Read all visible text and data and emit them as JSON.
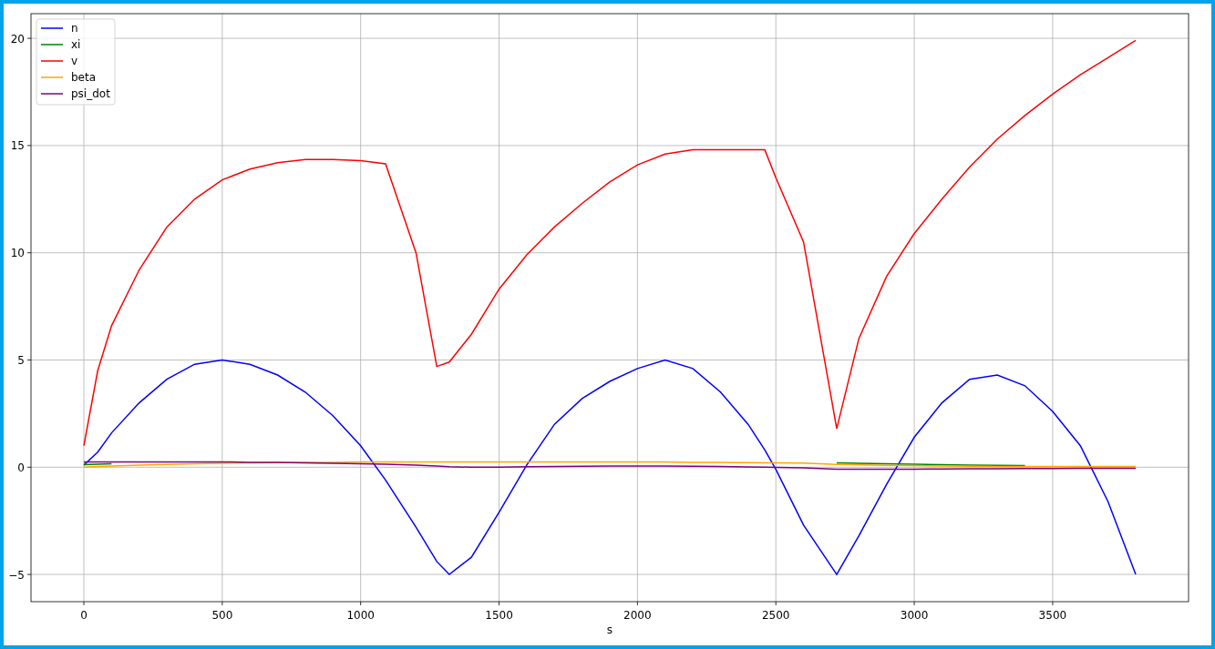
{
  "chart_data": {
    "type": "line",
    "xlabel": "s",
    "x": [
      0,
      50,
      100,
      200,
      300,
      400,
      500,
      600,
      700,
      800,
      900,
      1000,
      1090,
      1200,
      1275,
      1320,
      1400,
      1500,
      1600,
      1700,
      1800,
      1900,
      2000,
      2100,
      2200,
      2300,
      2400,
      2460,
      2500,
      2600,
      2720,
      2800,
      2900,
      3000,
      3100,
      3200,
      3300,
      3400,
      3500,
      3600,
      3700,
      3800
    ],
    "series": [
      {
        "name": "n",
        "color": "#0000ff",
        "values": [
          0.1,
          0.7,
          1.6,
          3,
          4.1,
          4.8,
          5,
          4.8,
          4.3,
          3.5,
          2.4,
          1.0,
          -0.6,
          -2.8,
          -4.4,
          -5,
          -4.2,
          -2.1,
          0.1,
          2,
          3.2,
          4,
          4.6,
          5,
          4.6,
          3.5,
          2,
          0.8,
          -0.1,
          -2.7,
          -5,
          -3.2,
          -0.8,
          1.4,
          3,
          4.1,
          4.3,
          3.8,
          2.6,
          1,
          -1.6,
          -5
        ]
      },
      {
        "name": "xi",
        "color": "#008000",
        "values": [
          0.12,
          0.14,
          0.16,
          null,
          null,
          null,
          null,
          null,
          null,
          null,
          null,
          null,
          null,
          null,
          null,
          null,
          null,
          null,
          null,
          null,
          null,
          null,
          null,
          null,
          null,
          null,
          null,
          null,
          null,
          null,
          0.2,
          0.18,
          0.16,
          0.14,
          0.12,
          0.1,
          0.09,
          0.08,
          null,
          null,
          null,
          null
        ]
      },
      {
        "name": "v",
        "color": "#ff0000",
        "values": [
          1,
          4.5,
          6.6,
          9.2,
          11.2,
          12.5,
          13.4,
          13.9,
          14.2,
          14.35,
          14.35,
          14.3,
          14.15,
          10,
          4.7,
          4.9,
          6.2,
          8.3,
          9.9,
          11.2,
          12.3,
          13.3,
          14.1,
          14.6,
          14.8,
          14.8,
          14.8,
          14.8,
          13.5,
          10.5,
          1.8,
          6,
          8.9,
          10.9,
          12.5,
          14,
          15.3,
          16.4,
          17.4,
          18.3,
          19.1,
          19.9
        ]
      },
      {
        "name": "beta",
        "color": "#ffa500",
        "values": [
          0,
          0.03,
          0.06,
          0.1,
          0.13,
          0.16,
          0.18,
          0.2,
          0.21,
          0.22,
          0.23,
          0.24,
          0.25,
          0.25,
          0.25,
          0.25,
          0.25,
          0.25,
          0.25,
          0.25,
          0.25,
          0.25,
          0.25,
          0.24,
          0.23,
          0.22,
          0.21,
          0.2,
          0.2,
          0.19,
          0.13,
          0.11,
          0.09,
          0.07,
          0.05,
          0.04,
          0.03,
          0.03,
          0.03,
          0.03,
          0.03,
          0.03
        ]
      },
      {
        "name": "psi_dot",
        "color": "#800080",
        "values": [
          0.25,
          0.25,
          0.25,
          0.25,
          0.25,
          0.25,
          0.25,
          0.23,
          0.22,
          0.2,
          0.18,
          0.16,
          0.14,
          0.1,
          0.05,
          0.02,
          0,
          0,
          0.02,
          0.03,
          0.04,
          0.05,
          0.05,
          0.05,
          0.04,
          0.03,
          0.01,
          0,
          -0.01,
          -0.03,
          -0.1,
          -0.1,
          -0.1,
          -0.09,
          -0.08,
          -0.07,
          -0.07,
          -0.06,
          -0.06,
          -0.05,
          -0.05,
          -0.05
        ]
      }
    ],
    "grid": true,
    "legend": true,
    "xlim": [
      -191,
      3991
    ],
    "ylim": [
      -6.27,
      21.15
    ],
    "xticks": [
      0,
      500,
      1000,
      1500,
      2000,
      2500,
      3000,
      3500
    ],
    "yticks": [
      {
        "value": -5,
        "label": "−5"
      },
      0,
      5,
      10,
      15,
      20
    ]
  }
}
